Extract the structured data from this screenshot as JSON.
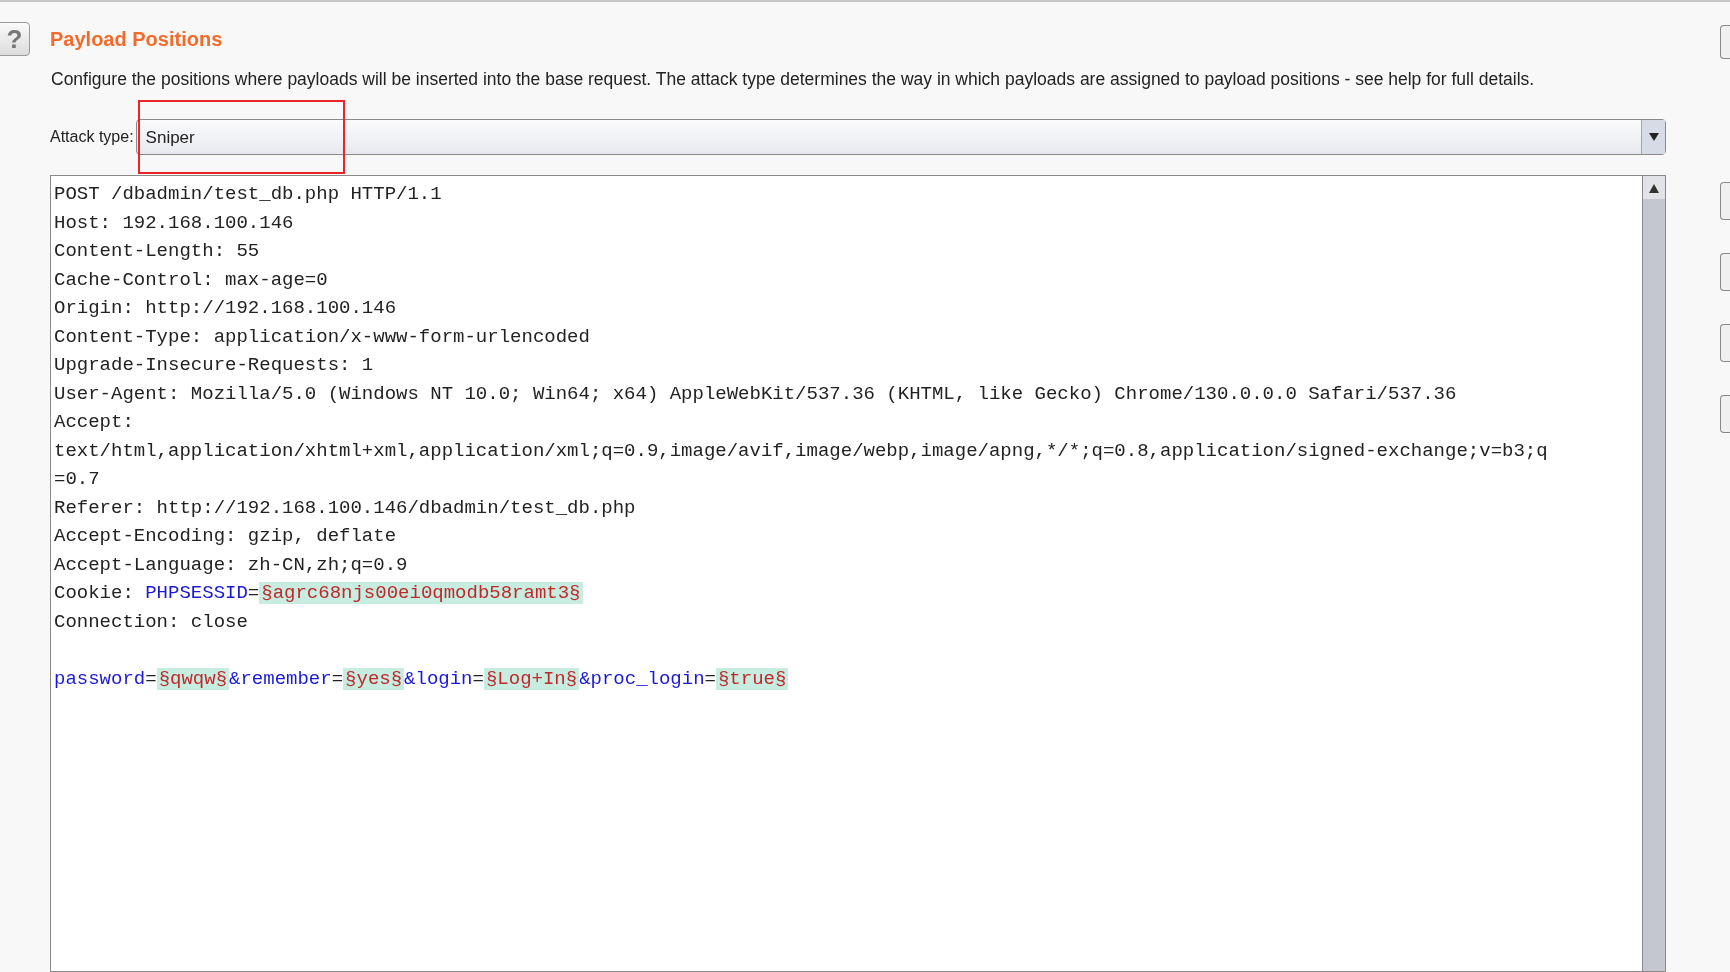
{
  "header": {
    "help_button": "?",
    "title": "Payload Positions",
    "description": "Configure the positions where payloads will be inserted into the base request. The attack type determines the way in which payloads are assigned to payload positions - see help for full details."
  },
  "attack_type": {
    "label": "Attack type:",
    "value": "Sniper",
    "highlighted": true
  },
  "request_lines": [
    [
      {
        "kind": "plain",
        "text": "POST /dbadmin/test_db.php HTTP/1.1"
      }
    ],
    [
      {
        "kind": "plain",
        "text": "Host: 192.168.100.146"
      }
    ],
    [
      {
        "kind": "plain",
        "text": "Content-Length: 55"
      }
    ],
    [
      {
        "kind": "plain",
        "text": "Cache-Control: max-age=0"
      }
    ],
    [
      {
        "kind": "plain",
        "text": "Origin: http://192.168.100.146"
      }
    ],
    [
      {
        "kind": "plain",
        "text": "Content-Type: application/x-www-form-urlencoded"
      }
    ],
    [
      {
        "kind": "plain",
        "text": "Upgrade-Insecure-Requests: 1"
      }
    ],
    [
      {
        "kind": "plain",
        "text": "User-Agent: Mozilla/5.0 (Windows NT 10.0; Win64; x64) AppleWebKit/537.36 (KHTML, like Gecko) Chrome/130.0.0.0 Safari/537.36"
      }
    ],
    [
      {
        "kind": "plain",
        "text": "Accept:"
      }
    ],
    [
      {
        "kind": "plain",
        "text": "text/html,application/xhtml+xml,application/xml;q=0.9,image/avif,image/webp,image/apng,*/*;q=0.8,application/signed-exchange;v=b3;q"
      }
    ],
    [
      {
        "kind": "plain",
        "text": "=0.7"
      }
    ],
    [
      {
        "kind": "plain",
        "text": "Referer: http://192.168.100.146/dbadmin/test_db.php"
      }
    ],
    [
      {
        "kind": "plain",
        "text": "Accept-Encoding: gzip, deflate"
      }
    ],
    [
      {
        "kind": "plain",
        "text": "Accept-Language: zh-CN,zh;q=0.9"
      }
    ],
    [
      {
        "kind": "plain",
        "text": "Cookie: "
      },
      {
        "kind": "param",
        "text": "PHPSESSID"
      },
      {
        "kind": "plain",
        "text": "="
      },
      {
        "kind": "payload",
        "text": "§agrc68njs00ei0qmodb58ramt3§"
      }
    ],
    [
      {
        "kind": "plain",
        "text": "Connection: close"
      }
    ],
    [
      {
        "kind": "blank"
      }
    ],
    [
      {
        "kind": "param",
        "text": "password"
      },
      {
        "kind": "plain",
        "text": "="
      },
      {
        "kind": "payload",
        "text": "§qwqw§"
      },
      {
        "kind": "param",
        "text": "&remember"
      },
      {
        "kind": "plain",
        "text": "="
      },
      {
        "kind": "payload",
        "text": "§yes§"
      },
      {
        "kind": "param",
        "text": "&login"
      },
      {
        "kind": "plain",
        "text": "="
      },
      {
        "kind": "payload",
        "text": "§Log+In§"
      },
      {
        "kind": "param",
        "text": "&proc_login"
      },
      {
        "kind": "plain",
        "text": "="
      },
      {
        "kind": "payload",
        "text": "§true§"
      }
    ]
  ]
}
